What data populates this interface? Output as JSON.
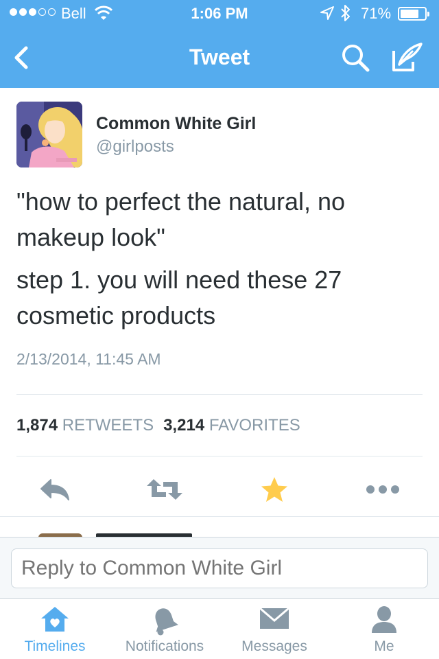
{
  "status_bar": {
    "carrier": "Bell",
    "time": "1:06 PM",
    "battery": "71%"
  },
  "nav": {
    "title": "Tweet"
  },
  "tweet": {
    "author_name": "Common White Girl",
    "author_handle": "@girlposts",
    "text_line1": "\"how to perfect the natural, no makeup look\"",
    "text_line2": "step 1. you will need these 27 cosmetic products",
    "timestamp": "2/13/2014, 11:45 AM",
    "retweets_count": "1,874",
    "retweets_label": "RETWEETS",
    "favorites_count": "3,214",
    "favorites_label": "FAVORITES"
  },
  "reply": {
    "placeholder": "Reply to Common White Girl"
  },
  "tabs": [
    {
      "label": "Timelines",
      "icon": "home-icon",
      "active": true
    },
    {
      "label": "Notifications",
      "icon": "bell-icon",
      "active": false
    },
    {
      "label": "Messages",
      "icon": "envelope-icon",
      "active": false
    },
    {
      "label": "Me",
      "icon": "person-icon",
      "active": false
    }
  ],
  "colors": {
    "brand_blue": "#55acee",
    "favorite_star": "#ffcc4d",
    "muted_text": "#8899a6",
    "icon_gray": "#8899a6"
  }
}
